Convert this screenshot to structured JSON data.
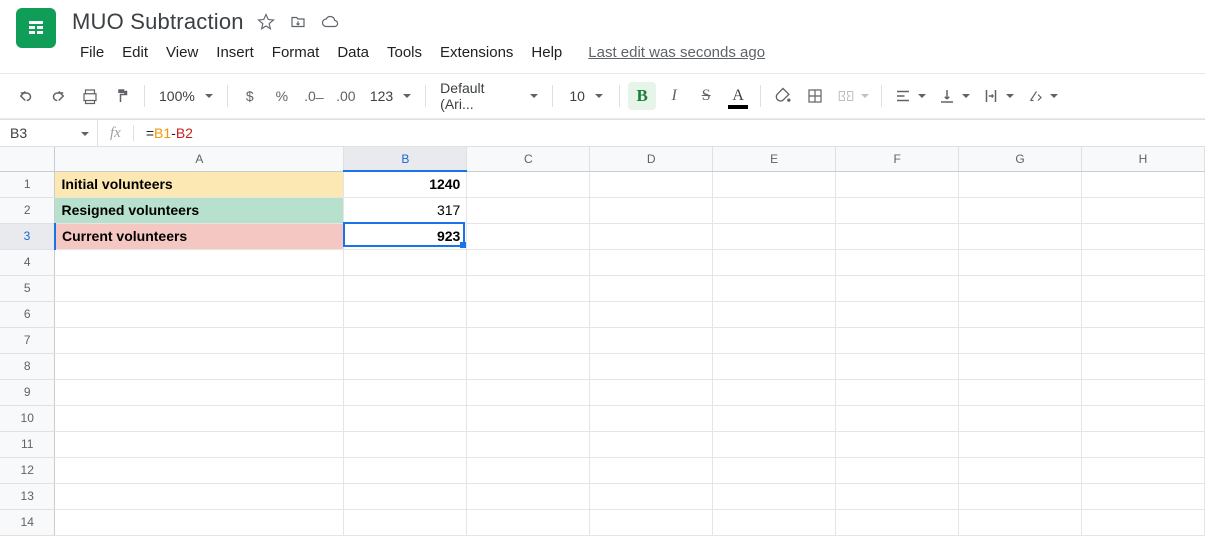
{
  "doc": {
    "title": "MUO Subtraction"
  },
  "menu": {
    "file": "File",
    "edit": "Edit",
    "view": "View",
    "insert": "Insert",
    "format": "Format",
    "data": "Data",
    "tools": "Tools",
    "extensions": "Extensions",
    "help": "Help",
    "last_edit": "Last edit was seconds ago"
  },
  "toolbar": {
    "zoom": "100%",
    "num123": "123",
    "font_name": "Default (Ari...",
    "font_size": "10",
    "bold": "B",
    "italic": "I",
    "strike": "S",
    "textcolor": "A",
    "decimal_less": ".0",
    "decimal_more": ".00"
  },
  "namebox": "B3",
  "formula": {
    "eq": "=",
    "ref1": "B1",
    "minus": "-",
    "ref2": "B2"
  },
  "columns": [
    "A",
    "B",
    "C",
    "D",
    "E",
    "F",
    "G",
    "H"
  ],
  "rows": [
    "1",
    "2",
    "3",
    "4",
    "5",
    "6",
    "7",
    "8",
    "9",
    "10",
    "11",
    "12",
    "13",
    "14"
  ],
  "cells": {
    "A1": "Initial volunteers",
    "A2": "Resigned volunteers",
    "A3": "Current volunteers",
    "B1": "1240",
    "B2": "317",
    "B3": "923"
  },
  "selection": {
    "col": "B",
    "row": "3"
  }
}
